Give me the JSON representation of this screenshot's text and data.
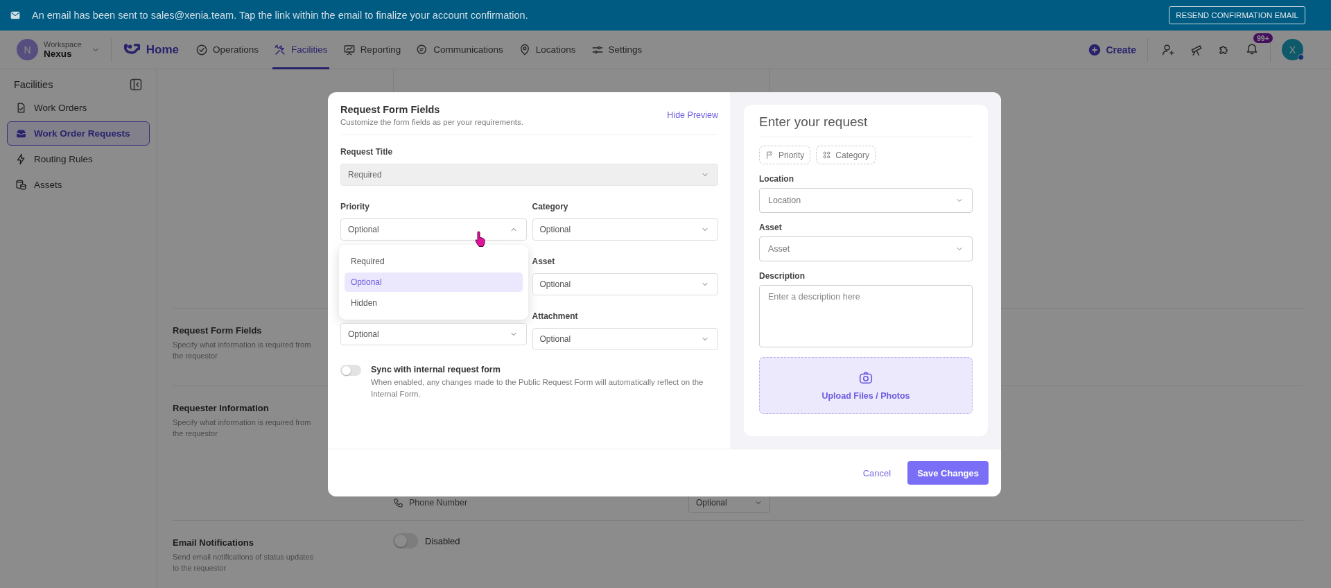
{
  "banner": {
    "message": "An email has been sent to sales@xenia.team. Tap the link within the email to finalize your account confirmation.",
    "action": "RESEND CONFIRMATION EMAIL"
  },
  "nav": {
    "workspace": {
      "initial": "N",
      "label": "Workspace",
      "name": "Nexus"
    },
    "home": "Home",
    "tabs": [
      {
        "label": "Operations",
        "selected": false
      },
      {
        "label": "Facilities",
        "selected": true
      },
      {
        "label": "Reporting",
        "selected": false
      },
      {
        "label": "Communications",
        "selected": false
      },
      {
        "label": "Locations",
        "selected": false
      },
      {
        "label": "Settings",
        "selected": false
      }
    ],
    "create": "Create",
    "notifications_badge": "99+",
    "avatar": "X"
  },
  "sidebar": {
    "title": "Facilities",
    "items": [
      {
        "label": "Work Orders",
        "selected": false
      },
      {
        "label": "Work Order Requests",
        "selected": true
      },
      {
        "label": "Routing Rules",
        "selected": false
      },
      {
        "label": "Assets",
        "selected": false
      }
    ]
  },
  "background": {
    "sections": [
      {
        "title": "Request Form Fields",
        "description": "Specify what information is required from the requestor"
      },
      {
        "title": "Requester Information",
        "description": "Specify what information is required from the requestor"
      },
      {
        "title": "Email Notifications",
        "description": "Send email notifications of status updates to the requestor"
      }
    ],
    "phone_row": {
      "label": "Phone Number",
      "value": "Optional"
    },
    "email_toggle": {
      "on": false,
      "label": "Disabled"
    }
  },
  "modal": {
    "title": "Request Form Fields",
    "subtitle": "Customize the form fields as per your requirements.",
    "hide_preview": "Hide Preview",
    "request_title": {
      "label": "Request Title",
      "value": "Required",
      "disabled": true
    },
    "left_fields": [
      {
        "label": "Priority",
        "value": "Optional",
        "expanded": true,
        "options": [
          {
            "label": "Required",
            "selected": false
          },
          {
            "label": "Optional",
            "selected": true
          },
          {
            "label": "Hidden",
            "selected": false
          }
        ]
      },
      {
        "value": "Optional",
        "expanded": false
      }
    ],
    "right_fields": [
      {
        "label": "Category",
        "value": "Optional",
        "expanded": false
      },
      {
        "label": "Asset",
        "value": "Optional",
        "expanded": false
      },
      {
        "label": "Attachment",
        "value": "Optional",
        "expanded": false
      }
    ],
    "sync": {
      "on": false,
      "label": "Sync with internal request form",
      "description": "When enabled, any changes made to the Public Request Form will automatically reflect on the Internal Form."
    },
    "preview": {
      "title": "Enter your request",
      "chips": [
        "Priority",
        "Category"
      ],
      "fields": [
        {
          "label": "Location",
          "placeholder": "Location",
          "kind": "select"
        },
        {
          "label": "Asset",
          "placeholder": "Asset",
          "kind": "select"
        },
        {
          "label": "Description",
          "placeholder": "Enter a description here",
          "kind": "textarea"
        }
      ],
      "upload": "Upload Files / Photos"
    },
    "buttons": {
      "cancel": "Cancel",
      "save": "Save Changes"
    }
  }
}
